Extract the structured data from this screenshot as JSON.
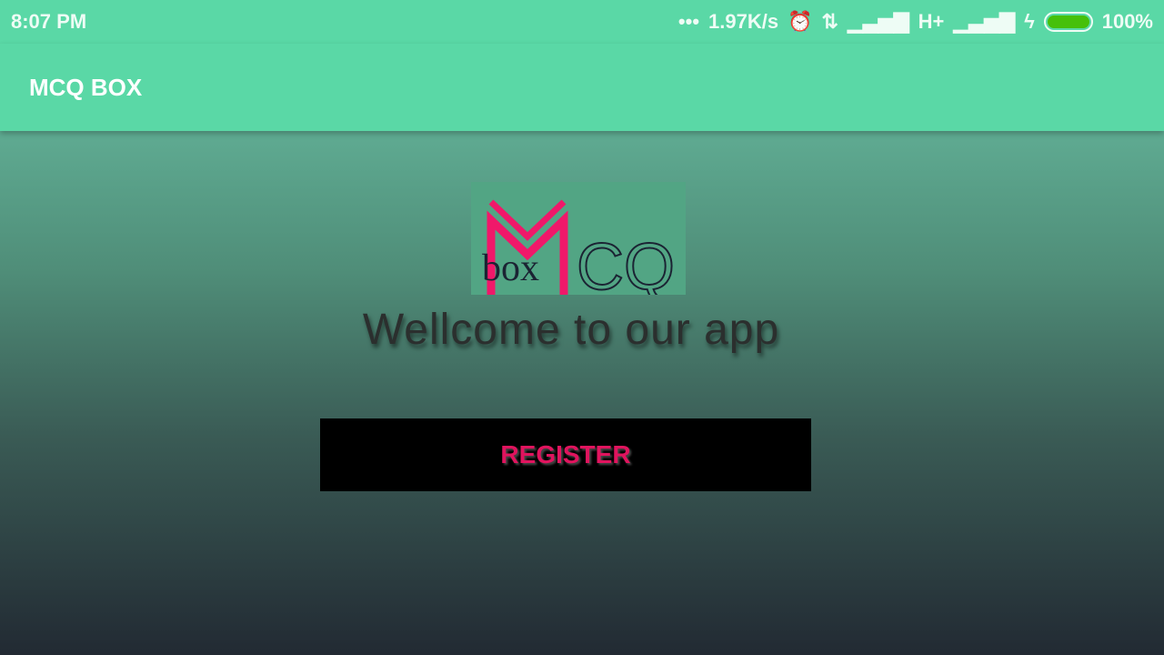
{
  "status": {
    "time": "8:07 PM",
    "speed": "1.97K/s",
    "network": "H+",
    "battery": "100%",
    "battery_level": 1.0
  },
  "app": {
    "title": "MCQ BOX"
  },
  "logo": {
    "text_m": "M",
    "text_box": "box",
    "text_cq": "CQ"
  },
  "welcome": "Wellcome to our app",
  "register_label": "REGISTER",
  "colors": {
    "accent": "#5ad8a6",
    "pink": "#e0145e"
  }
}
